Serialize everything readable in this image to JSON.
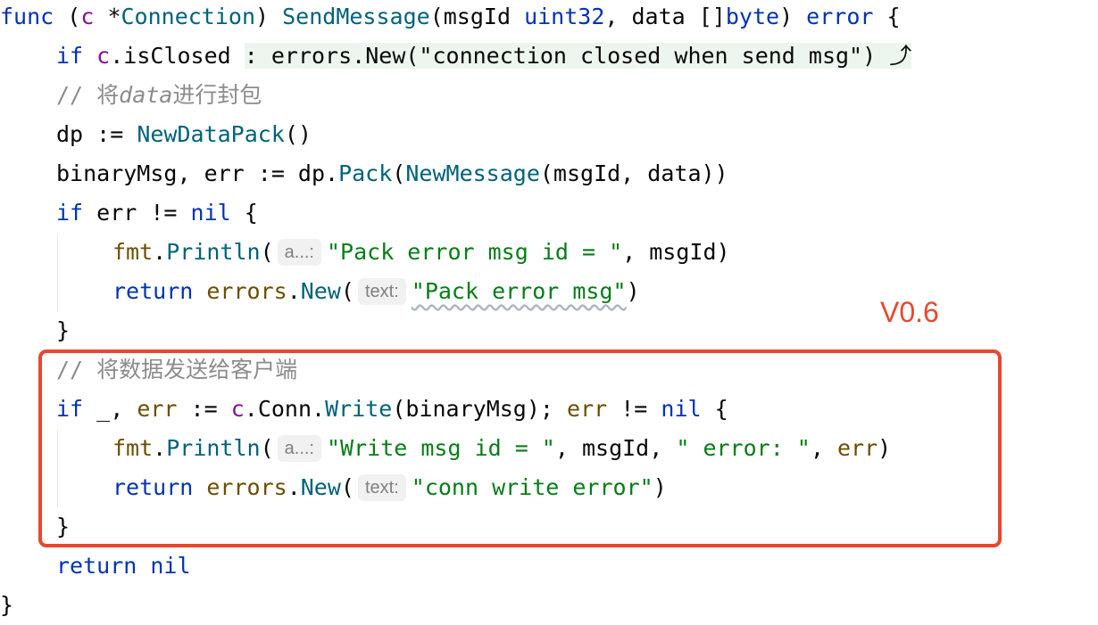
{
  "annotation": {
    "label": "V0.6",
    "color": "#e8472e"
  },
  "colors": {
    "keyword": "#0033b3",
    "function": "#00627a",
    "package": "#6b4f00",
    "string": "#067d17",
    "comment": "#8c8c8c",
    "receiver": "#871094",
    "fold_background": "#edf6ee"
  },
  "code": {
    "lines": [
      {
        "indent": 0,
        "tokens": [
          {
            "t": "func",
            "c": "kw"
          },
          {
            "t": " (",
            "c": "plain"
          },
          {
            "t": "c",
            "c": "recv"
          },
          {
            "t": " *",
            "c": "plain"
          },
          {
            "t": "Connection",
            "c": "fn"
          },
          {
            "t": ") ",
            "c": "plain"
          },
          {
            "t": "SendMessage",
            "c": "fn"
          },
          {
            "t": "(msgId ",
            "c": "plain"
          },
          {
            "t": "uint32",
            "c": "kw"
          },
          {
            "t": ", data []",
            "c": "plain"
          },
          {
            "t": "byte",
            "c": "kw"
          },
          {
            "t": ") ",
            "c": "plain"
          },
          {
            "t": "error",
            "c": "kw"
          },
          {
            "t": " {",
            "c": "plain"
          }
        ]
      },
      {
        "indent": 1,
        "tokens": [
          {
            "t": "if",
            "c": "kw"
          },
          {
            "t": " ",
            "c": "plain"
          },
          {
            "t": "c",
            "c": "recv"
          },
          {
            "t": ".isClosed ",
            "c": "plain"
          },
          {
            "t": ": errors.New(\"connection closed when send msg\") ⤴",
            "c": "folded"
          }
        ]
      },
      {
        "indent": 1,
        "tokens": [
          {
            "t": "// 将",
            "c": "cmt"
          },
          {
            "t": "data",
            "c": "cmt-i"
          },
          {
            "t": "进行封包",
            "c": "cmt"
          }
        ]
      },
      {
        "indent": 1,
        "tokens": [
          {
            "t": "dp := ",
            "c": "plain"
          },
          {
            "t": "NewDataPack",
            "c": "fn"
          },
          {
            "t": "()",
            "c": "plain"
          }
        ]
      },
      {
        "indent": 1,
        "tokens": [
          {
            "t": "binaryMsg, err := dp.",
            "c": "plain"
          },
          {
            "t": "Pack",
            "c": "fn"
          },
          {
            "t": "(",
            "c": "plain"
          },
          {
            "t": "NewMessage",
            "c": "fn"
          },
          {
            "t": "(msgId, data))",
            "c": "plain"
          }
        ]
      },
      {
        "indent": 1,
        "tokens": [
          {
            "t": "if",
            "c": "kw"
          },
          {
            "t": " err != ",
            "c": "plain"
          },
          {
            "t": "nil",
            "c": "kw"
          },
          {
            "t": " {",
            "c": "plain"
          }
        ]
      },
      {
        "indent": 2,
        "tokens": [
          {
            "t": "fmt",
            "c": "pkg"
          },
          {
            "t": ".",
            "c": "plain"
          },
          {
            "t": "Println",
            "c": "fn"
          },
          {
            "t": "(",
            "c": "plain"
          },
          {
            "t": "a...:",
            "c": "hint"
          },
          {
            "t": "\"Pack error msg id = \"",
            "c": "str"
          },
          {
            "t": ", msgId)",
            "c": "plain"
          }
        ]
      },
      {
        "indent": 2,
        "tokens": [
          {
            "t": "return",
            "c": "kw"
          },
          {
            "t": " ",
            "c": "plain"
          },
          {
            "t": "errors",
            "c": "pkg"
          },
          {
            "t": ".",
            "c": "plain"
          },
          {
            "t": "New",
            "c": "fn"
          },
          {
            "t": "(",
            "c": "plain"
          },
          {
            "t": "text:",
            "c": "hint"
          },
          {
            "t": "\"Pack error msg\"",
            "c": "str squig"
          },
          {
            "t": ")",
            "c": "plain"
          }
        ]
      },
      {
        "indent": 1,
        "tokens": [
          {
            "t": "}",
            "c": "plain"
          }
        ]
      },
      {
        "indent": 1,
        "tokens": [
          {
            "t": "// 将数据发送给客户端",
            "c": "cmt"
          }
        ]
      },
      {
        "indent": 1,
        "tokens": [
          {
            "t": "if",
            "c": "kw"
          },
          {
            "t": " _, ",
            "c": "plain"
          },
          {
            "t": "err",
            "c": "pkg"
          },
          {
            "t": " := ",
            "c": "plain"
          },
          {
            "t": "c",
            "c": "recv"
          },
          {
            "t": ".Conn.",
            "c": "plain"
          },
          {
            "t": "Write",
            "c": "fn"
          },
          {
            "t": "(binaryMsg); ",
            "c": "plain"
          },
          {
            "t": "err",
            "c": "pkg"
          },
          {
            "t": " != ",
            "c": "plain"
          },
          {
            "t": "nil",
            "c": "kw"
          },
          {
            "t": " {",
            "c": "plain"
          }
        ]
      },
      {
        "indent": 2,
        "tokens": [
          {
            "t": "fmt",
            "c": "pkg"
          },
          {
            "t": ".",
            "c": "plain"
          },
          {
            "t": "Println",
            "c": "fn"
          },
          {
            "t": "(",
            "c": "plain"
          },
          {
            "t": "a...:",
            "c": "hint"
          },
          {
            "t": "\"Write msg id = \"",
            "c": "str"
          },
          {
            "t": ", msgId, ",
            "c": "plain"
          },
          {
            "t": "\" error: \"",
            "c": "str"
          },
          {
            "t": ", ",
            "c": "plain"
          },
          {
            "t": "err",
            "c": "pkg"
          },
          {
            "t": ")",
            "c": "plain"
          }
        ]
      },
      {
        "indent": 2,
        "tokens": [
          {
            "t": "return",
            "c": "kw"
          },
          {
            "t": " ",
            "c": "plain"
          },
          {
            "t": "errors",
            "c": "pkg"
          },
          {
            "t": ".",
            "c": "plain"
          },
          {
            "t": "New",
            "c": "fn"
          },
          {
            "t": "(",
            "c": "plain"
          },
          {
            "t": "text:",
            "c": "hint"
          },
          {
            "t": "\"conn write error\"",
            "c": "str"
          },
          {
            "t": ")",
            "c": "plain"
          }
        ]
      },
      {
        "indent": 1,
        "tokens": [
          {
            "t": "}",
            "c": "plain"
          }
        ]
      },
      {
        "indent": 1,
        "tokens": [
          {
            "t": "return",
            "c": "kw"
          },
          {
            "t": " ",
            "c": "plain"
          },
          {
            "t": "nil",
            "c": "kw"
          }
        ]
      },
      {
        "indent": 0,
        "tokens": [
          {
            "t": "}",
            "c": "plain"
          }
        ]
      }
    ]
  }
}
